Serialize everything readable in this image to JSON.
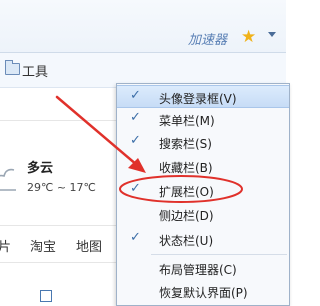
{
  "toolbar": {
    "accelerator_label": "加速器",
    "star_icon": "star-icon",
    "dropdown_icon": "chevron-down-icon"
  },
  "bookmarks": {
    "tools_label": "工具",
    "folder_icon": "folder-icon"
  },
  "weather": {
    "condition": "多云",
    "temperature": "29℃ ~ 17℃",
    "icon": "cloud-icon"
  },
  "nav": {
    "links": [
      "片",
      "淘宝",
      "地图"
    ]
  },
  "context_menu": {
    "items": [
      {
        "label": "头像登录框(V)",
        "checked": true
      },
      {
        "label": "菜单栏(M)",
        "checked": true
      },
      {
        "label": "搜索栏(S)",
        "checked": true
      },
      {
        "label": "收藏栏(B)",
        "checked": true
      },
      {
        "label": "扩展栏(O)",
        "checked": true
      },
      {
        "label": "侧边栏(D)",
        "checked": false
      },
      {
        "label": "状态栏(U)",
        "checked": true
      },
      {
        "label": "布局管理器(C)",
        "checked": false
      },
      {
        "label": "恢复默认界面(P)",
        "checked": false
      }
    ],
    "check_glyph": "✓"
  },
  "colors": {
    "accent": "#3d6fa8",
    "annotation": "#e0312b",
    "menu_highlight": "#c7dcf6"
  }
}
